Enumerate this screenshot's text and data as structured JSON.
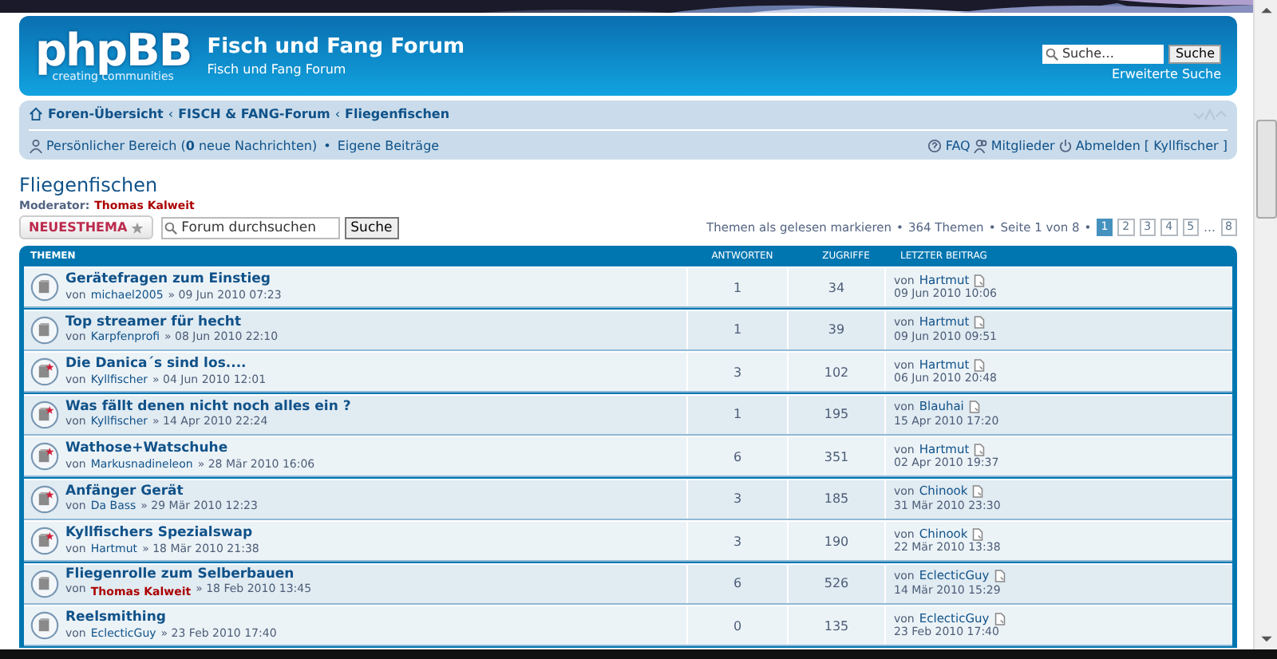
{
  "header": {
    "logo_text": "phpBB",
    "logo_tagline": "creating communities",
    "site_title": "Fisch und Fang Forum",
    "site_description": "Fisch und Fang Forum",
    "search_placeholder": "Suche…",
    "search_button": "Suche",
    "advanced_search": "Erweiterte Suche"
  },
  "breadcrumbs": [
    {
      "label": "Foren-Übersicht"
    },
    {
      "separator": "‹",
      "label": "FISCH & FANG-Forum"
    },
    {
      "separator": "‹",
      "label": "Fliegenfischen"
    }
  ],
  "user_bar": {
    "personal": "Persönlicher Bereich (**0** neue Nachrichten)",
    "bullet": "•",
    "own_posts": "Eigene Beiträge",
    "faq": "FAQ",
    "members": "Mitglieder",
    "logout": "Abmelden [ Kyllfischer ]"
  },
  "forum": {
    "title": "Fliegenfischen",
    "moderator_label": "Moderator:",
    "moderator": "Thomas Kalweit",
    "new_topic": "NEUESTHEMA",
    "search_placeholder": "Forum durchsuchen",
    "search_button": "Suche",
    "mark_read": "Themen als gelesen markieren",
    "bullet_1": "•",
    "topic_count": "364 Themen",
    "bullet_2": "•",
    "page_info": "Seite 1 von 8",
    "bullet_3": "•",
    "ellipsis": "…",
    "pages": [
      {
        "label": "1",
        "selected": true
      },
      {
        "label": "2",
        "selected": false
      },
      {
        "label": "3",
        "selected": false
      },
      {
        "label": "4",
        "selected": false
      },
      {
        "label": "5",
        "selected": false
      }
    ],
    "last_page": {
      "label": "8",
      "selected": false
    }
  },
  "table": {
    "columns": [
      "THEMEN",
      "ANTWORTEN",
      "ZUGRIFFE",
      "LETZTER BEITRAG"
    ],
    "rows": [
      {
        "title": "Gerätefragen zum Einstieg",
        "by": "von",
        "author": "michael2005",
        "author_moderator": false,
        "date": "» 09 Jun 2010 07:23",
        "unread": false,
        "replies": "1",
        "views": "34",
        "last_by": "von",
        "last_author": "Hartmut",
        "last_date": "09 Jun 2010 10:06"
      },
      {
        "title": "Top streamer für hecht",
        "by": "von",
        "author": "Karpfenprofi",
        "author_moderator": false,
        "date": "» 08 Jun 2010 22:10",
        "unread": false,
        "replies": "1",
        "views": "39",
        "last_by": "von",
        "last_author": "Hartmut",
        "last_date": "09 Jun 2010 09:51"
      },
      {
        "title": "Die Danica´s sind los....",
        "by": "von",
        "author": "Kyllfischer",
        "author_moderator": false,
        "date": "» 04 Jun 2010 12:01",
        "unread": true,
        "replies": "3",
        "views": "102",
        "last_by": "von",
        "last_author": "Hartmut",
        "last_date": "06 Jun 2010 20:48"
      },
      {
        "title": "Was fällt denen nicht noch alles ein ?",
        "by": "von",
        "author": "Kyllfischer",
        "author_moderator": false,
        "date": "» 14 Apr 2010 22:24",
        "unread": true,
        "replies": "1",
        "views": "195",
        "last_by": "von",
        "last_author": "Blauhai",
        "last_date": "15 Apr 2010 17:20"
      },
      {
        "title": "Wathose+Watschuhe",
        "by": "von",
        "author": "Markusnadineleon",
        "author_moderator": false,
        "date": "» 28 Mär 2010 16:06",
        "unread": true,
        "replies": "6",
        "views": "351",
        "last_by": "von",
        "last_author": "Hartmut",
        "last_date": "02 Apr 2010 19:37"
      },
      {
        "title": "Anfänger Gerät",
        "by": "von",
        "author": "Da Bass",
        "author_moderator": false,
        "date": "» 29 Mär 2010 12:23",
        "unread": true,
        "replies": "3",
        "views": "185",
        "last_by": "von",
        "last_author": "Chinook",
        "last_date": "31 Mär 2010 23:30"
      },
      {
        "title": "Kyllfischers Spezialswap",
        "by": "von",
        "author": "Hartmut",
        "author_moderator": false,
        "date": "» 18 Mär 2010 21:38",
        "unread": true,
        "replies": "3",
        "views": "190",
        "last_by": "von",
        "last_author": "Chinook",
        "last_date": "22 Mär 2010 13:38"
      },
      {
        "title": "Fliegenrolle zum Selberbauen",
        "by": "von",
        "author": "Thomas Kalweit",
        "author_moderator": true,
        "date": "» 18 Feb 2010 13:45",
        "unread": false,
        "replies": "6",
        "views": "526",
        "last_by": "von",
        "last_author": "EclecticGuy",
        "last_date": "14 Mär 2010 15:29"
      },
      {
        "title": "Reelsmithing",
        "by": "von",
        "author": "EclecticGuy",
        "author_moderator": false,
        "date": "» 23 Feb 2010 17:40",
        "unread": false,
        "replies": "0",
        "views": "135",
        "last_by": "von",
        "last_author": "EclecticGuy",
        "last_date": "23 Feb 2010 17:40"
      }
    ]
  }
}
